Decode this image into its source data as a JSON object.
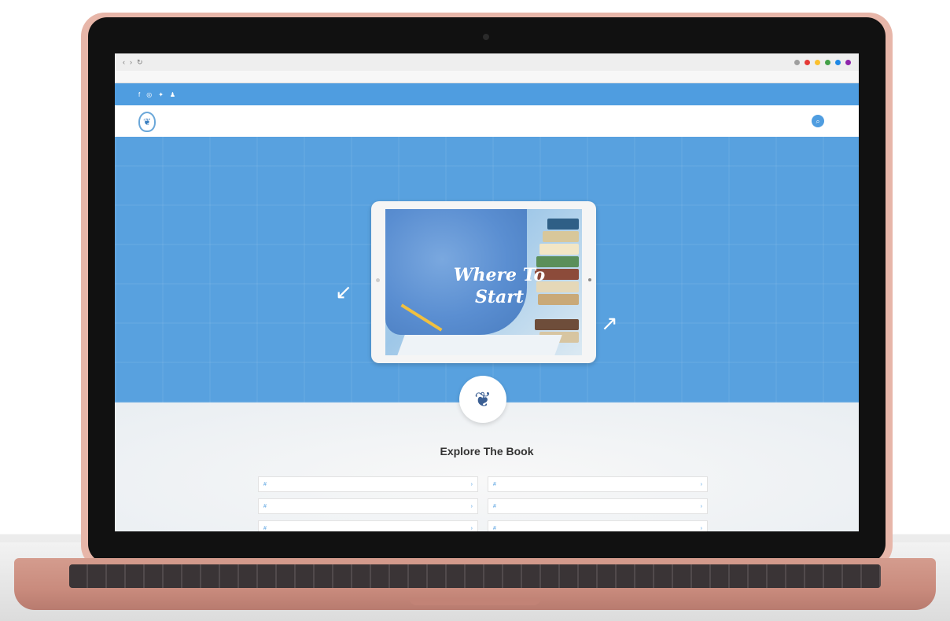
{
  "browser": {
    "url": "",
    "nav_back": "‹",
    "nav_forward": "›",
    "nav_reload": "↻",
    "ext_colors": [
      "#9e9e9e",
      "#e53935",
      "#fbc02d",
      "#43a047",
      "#1e88e5",
      "#8e24aa"
    ],
    "bookmarks": [
      "",
      "",
      "",
      "",
      "",
      "",
      "",
      "",
      "",
      "",
      "",
      ""
    ]
  },
  "topbar": {
    "social_icons": [
      "facebook-icon",
      "instagram-icon",
      "twitter-icon",
      "user-icon"
    ],
    "social_glyphs": [
      "f",
      "◎",
      "✦",
      "♟"
    ],
    "links": [
      "",
      "",
      "",
      ""
    ]
  },
  "nav": {
    "logo_glyph": "❦",
    "links": [
      "",
      "",
      "",
      "",
      "",
      "",
      ""
    ],
    "search_glyph": "⌕"
  },
  "hero": {
    "tagline": "",
    "tablet_title": "Where To Start",
    "left_text": "",
    "right_text": "",
    "arrow_left": "↙",
    "arrow_right": "↗"
  },
  "explore": {
    "emblem_glyph": "❦",
    "title": "Explore The Book",
    "cards": [
      {
        "label": "",
        "icon": "#",
        "arrow": "›"
      },
      {
        "label": "",
        "icon": "#",
        "arrow": "›"
      },
      {
        "label": "",
        "icon": "#",
        "arrow": "›"
      },
      {
        "label": "",
        "icon": "#",
        "arrow": "›"
      },
      {
        "label": "",
        "icon": "#",
        "arrow": "›"
      },
      {
        "label": "",
        "icon": "#",
        "arrow": "›"
      }
    ]
  },
  "colors": {
    "brand_blue": "#4f9de0",
    "hero_blue": "#58a1df",
    "laptop_rose": "#e7b6a9"
  }
}
